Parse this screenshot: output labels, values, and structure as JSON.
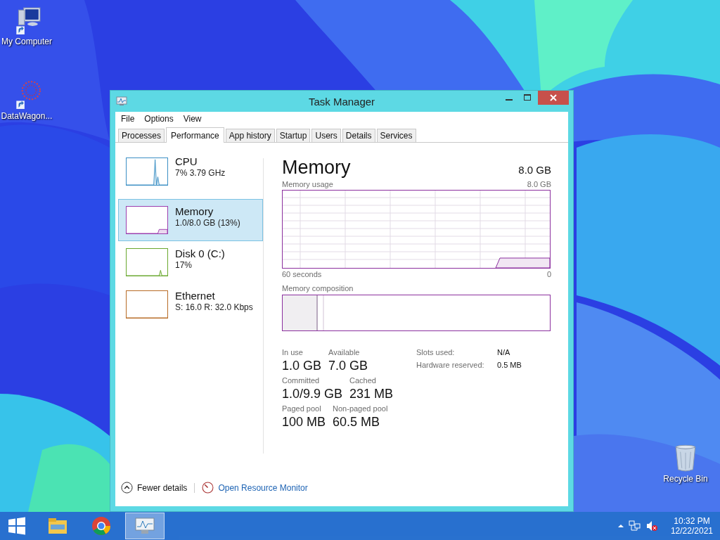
{
  "desktop_icons": [
    {
      "kind": "computer",
      "label": "My Computer"
    },
    {
      "kind": "app",
      "label": "DataWagon..."
    },
    {
      "kind": "bin",
      "label": "Recycle Bin"
    }
  ],
  "window": {
    "title": "Task Manager"
  },
  "menu": [
    "File",
    "Options",
    "View"
  ],
  "tabs": [
    {
      "label": "Processes",
      "selected": false
    },
    {
      "label": "Performance",
      "selected": true
    },
    {
      "label": "App history",
      "selected": false
    },
    {
      "label": "Startup",
      "selected": false
    },
    {
      "label": "Users",
      "selected": false
    },
    {
      "label": "Details",
      "selected": false
    },
    {
      "label": "Services",
      "selected": false
    }
  ],
  "resources": [
    {
      "kind": "cpu",
      "name": "CPU",
      "detail": "7%  3.79 GHz",
      "color": "#3b8fc4",
      "selected": false
    },
    {
      "kind": "memory",
      "name": "Memory",
      "detail": "1.0/8.0 GB (13%)",
      "color": "#9b3fae",
      "selected": true
    },
    {
      "kind": "disk",
      "name": "Disk 0 (C:)",
      "detail": "17%",
      "color": "#6aa82e",
      "selected": false
    },
    {
      "kind": "ethernet",
      "name": "Ethernet",
      "detail": "S: 16.0 R: 32.0 Kbps",
      "color": "#b76b26",
      "selected": false
    }
  ],
  "detail": {
    "title": "Memory",
    "total": "8.0 GB",
    "usage_label": "Memory usage",
    "usage_max": "8.0 GB",
    "time_label": "60 seconds",
    "time_end": "0",
    "composition_label": "Memory composition",
    "stat_rows": [
      {
        "items": [
          {
            "label": "In use",
            "value": "1.0 GB"
          },
          {
            "label": "Available",
            "value": "7.0 GB"
          }
        ]
      },
      {
        "items": [
          {
            "label": "Committed",
            "value": "1.0/9.9 GB"
          },
          {
            "label": "Cached",
            "value": "231 MB"
          }
        ]
      },
      {
        "items": [
          {
            "label": "Paged pool",
            "value": "100 MB"
          },
          {
            "label": "Non-paged pool",
            "value": "60.5 MB"
          }
        ]
      }
    ],
    "extra": [
      {
        "label": "Slots used:",
        "value": "N/A"
      },
      {
        "label": "Hardware reserved:",
        "value": "0.5 MB"
      }
    ]
  },
  "footer": {
    "fewer": "Fewer details",
    "monitor": "Open Resource Monitor"
  },
  "taskbar": {
    "apps": [
      {
        "kind": "explorer",
        "selected": false
      },
      {
        "kind": "chrome",
        "selected": false
      },
      {
        "kind": "taskmanager",
        "selected": true
      }
    ],
    "time": "10:32 PM",
    "date": "12/22/2021"
  }
}
